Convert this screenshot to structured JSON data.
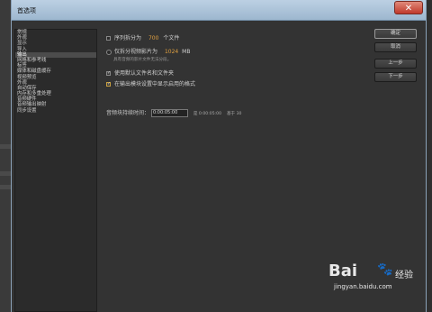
{
  "window": {
    "title": "首选项",
    "close_glyph": "✕"
  },
  "categories": [
    {
      "label": "常规",
      "selected": false
    },
    {
      "label": "外观",
      "selected": false
    },
    {
      "label": "显示",
      "selected": false
    },
    {
      "label": "导入",
      "selected": false
    },
    {
      "label": "输出",
      "selected": true
    },
    {
      "label": "网格和参考线",
      "selected": false
    },
    {
      "label": "标签",
      "selected": false
    },
    {
      "label": "媒体和磁盘缓存",
      "selected": false
    },
    {
      "label": "视频预览",
      "selected": false
    },
    {
      "label": "外观",
      "selected": false
    },
    {
      "label": "自动保存",
      "selected": false
    },
    {
      "label": "内存和多重处理",
      "selected": false
    },
    {
      "label": "音频硬件",
      "selected": false
    },
    {
      "label": "音频输出映射",
      "selected": false
    },
    {
      "label": "同步设置",
      "selected": false
    }
  ],
  "settings": {
    "segment_checkbox": {
      "prefix": "序列拆分为",
      "value": "700",
      "suffix": "个文件",
      "checked": false
    },
    "video_radio": {
      "prefix": "仅拆分视频影片为",
      "value": "1024",
      "suffix": "MB",
      "selected": false
    },
    "video_note": "具有音频的影片文件无法分段。",
    "default_names": {
      "label": "使用默认文件名和文件夹",
      "checked": true
    },
    "show_disabled": {
      "label": "在输出模块设置中显示启用的格式",
      "checked": true
    },
    "audio_duration": {
      "label": "音频块持续时间：",
      "value": "0:00:05:00",
      "equals_text": "是 0:00:05:00",
      "base_text": "基于 30"
    }
  },
  "buttons": {
    "ok": "确定",
    "cancel": "取消",
    "prev": "上一步",
    "next": "下一步"
  },
  "watermark": {
    "brand": "Bai",
    "paw": "🐾",
    "cn": "经验",
    "url": "jingyan.baidu.com"
  }
}
